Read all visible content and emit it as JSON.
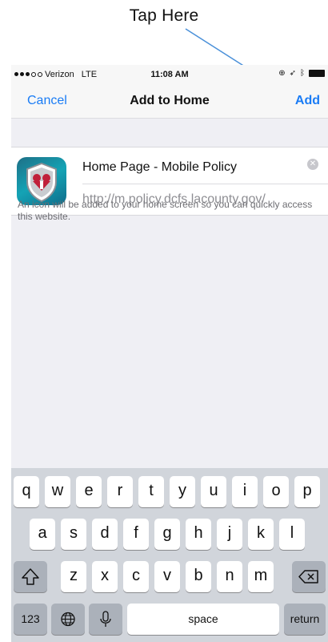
{
  "annotation": {
    "label": "Tap Here"
  },
  "status_bar": {
    "carrier": "Verizon",
    "network": "LTE",
    "time": "11:08 AM"
  },
  "nav": {
    "cancel": "Cancel",
    "title": "Add to Home",
    "add": "Add"
  },
  "bookmark": {
    "title": "Home Page - Mobile Policy",
    "url": "http://m.policy.dcfs.lacounty.gov/",
    "hint": "An icon will be added to your home screen so you can quickly access this website."
  },
  "keyboard": {
    "row1": [
      "q",
      "w",
      "e",
      "r",
      "t",
      "y",
      "u",
      "i",
      "o",
      "p"
    ],
    "row2": [
      "a",
      "s",
      "d",
      "f",
      "g",
      "h",
      "j",
      "k",
      "l"
    ],
    "row3": [
      "z",
      "x",
      "c",
      "v",
      "b",
      "n",
      "m"
    ],
    "numbers": "123",
    "space": "space",
    "return": "return"
  },
  "colors": {
    "accent": "#1a7cf5",
    "arrow": "#4a90d9"
  }
}
